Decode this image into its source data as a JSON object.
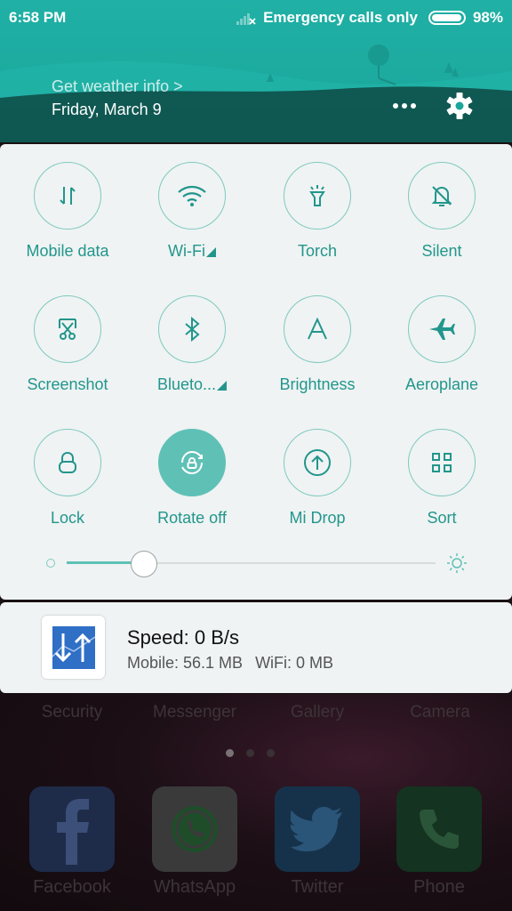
{
  "status_bar": {
    "time": "6:58 PM",
    "network_text": "Emergency calls only",
    "battery_percent": "98%",
    "battery_level": 0.98
  },
  "header": {
    "weather_link": "Get weather info >",
    "date": "Friday, March 9",
    "accent_color": "#1aa69b"
  },
  "toggles": [
    {
      "label": "Mobile data",
      "icon": "mobile-data-icon",
      "active": false,
      "has_submenu": false
    },
    {
      "label": "Wi-Fi",
      "icon": "wifi-icon",
      "active": false,
      "has_submenu": true
    },
    {
      "label": "Torch",
      "icon": "torch-icon",
      "active": false,
      "has_submenu": false
    },
    {
      "label": "Silent",
      "icon": "silent-bell-icon",
      "active": false,
      "has_submenu": false
    },
    {
      "label": "Screenshot",
      "icon": "screenshot-scissors-icon",
      "active": false,
      "has_submenu": false
    },
    {
      "label": "Blueto...",
      "icon": "bluetooth-icon",
      "active": false,
      "has_submenu": true
    },
    {
      "label": "Brightness",
      "icon": "brightness-a-icon",
      "active": false,
      "has_submenu": false
    },
    {
      "label": "Aeroplane",
      "icon": "aeroplane-icon",
      "active": false,
      "has_submenu": false
    },
    {
      "label": "Lock",
      "icon": "lock-icon",
      "active": false,
      "has_submenu": false
    },
    {
      "label": "Rotate off",
      "icon": "rotate-lock-icon",
      "active": true,
      "has_submenu": false
    },
    {
      "label": "Mi Drop",
      "icon": "mi-drop-upload-icon",
      "active": false,
      "has_submenu": false
    },
    {
      "label": "Sort",
      "icon": "grid-sort-icon",
      "active": false,
      "has_submenu": false
    }
  ],
  "brightness": {
    "level": 0.21,
    "toggle_color": "#5fc1b6"
  },
  "notification": {
    "icon": "speed-arrows-icon",
    "title": "Speed: 0 B/s",
    "mobile_usage": "Mobile: 56.1 MB",
    "wifi_usage": "WiFi: 0 MB"
  },
  "home_screen": {
    "row_labels": [
      "Security",
      "Messenger",
      "Gallery",
      "Camera"
    ],
    "page_count": 3,
    "current_page": 1,
    "dock": [
      {
        "label": "Facebook",
        "icon": "facebook-icon",
        "color": "#1e2c4a"
      },
      {
        "label": "WhatsApp",
        "icon": "whatsapp-icon",
        "color": "#3a3a3a"
      },
      {
        "label": "Twitter",
        "icon": "twitter-icon",
        "color": "#16324a"
      },
      {
        "label": "Phone",
        "icon": "phone-icon",
        "color": "#143320"
      }
    ]
  }
}
